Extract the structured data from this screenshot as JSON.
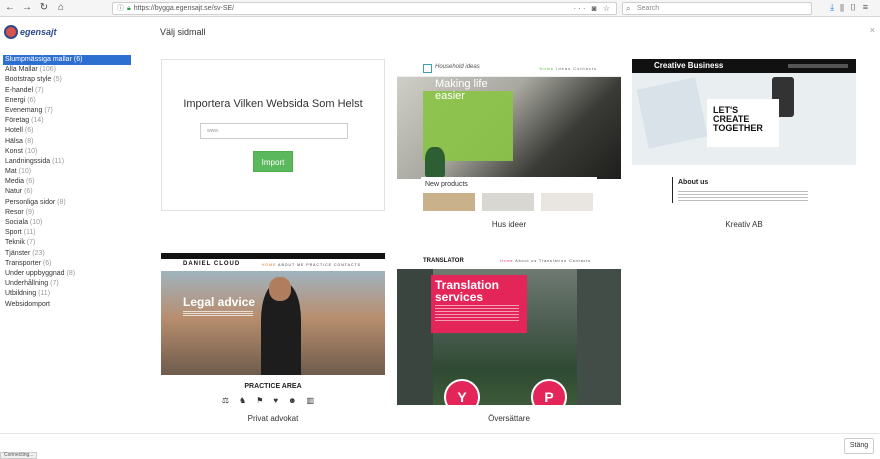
{
  "browser": {
    "url": "https://bygga.egensajt.se/sv-SE/",
    "search_placeholder": "Search",
    "icons": [
      "back-icon",
      "forward-icon",
      "reload-icon",
      "home-icon",
      "info-icon",
      "lock-icon",
      "more-icon",
      "pocket-icon",
      "star-icon",
      "search-icon",
      "download-icon",
      "library-icon",
      "sidebar-icon",
      "menu-icon"
    ]
  },
  "header": {
    "logo_text": "egensajt",
    "title": "Välj sidmall",
    "close_glyph": "×"
  },
  "sidebar": {
    "items": [
      {
        "label": "Slumpmässiga mallar",
        "count": "(6)",
        "active": true
      },
      {
        "label": "Alla Mallar",
        "count": "(106)"
      },
      {
        "label": "Bootstrap style",
        "count": "(5)"
      },
      {
        "label": "E-handel",
        "count": "(7)"
      },
      {
        "label": "Energi",
        "count": "(6)"
      },
      {
        "label": "Evenemang",
        "count": "(7)"
      },
      {
        "label": "Företag",
        "count": "(14)"
      },
      {
        "label": "Hotell",
        "count": "(6)"
      },
      {
        "label": "Hälsa",
        "count": "(8)"
      },
      {
        "label": "Konst",
        "count": "(10)"
      },
      {
        "label": "Landningssida",
        "count": "(11)"
      },
      {
        "label": "Mat",
        "count": "(10)"
      },
      {
        "label": "Media",
        "count": "(6)"
      },
      {
        "label": "Natur",
        "count": "(6)"
      },
      {
        "label": "Personliga sidor",
        "count": "(8)"
      },
      {
        "label": "Resor",
        "count": "(9)"
      },
      {
        "label": "Sociala",
        "count": "(10)"
      },
      {
        "label": "Sport",
        "count": "(11)"
      },
      {
        "label": "Teknik",
        "count": "(7)"
      },
      {
        "label": "Tjänster",
        "count": "(23)"
      },
      {
        "label": "Transporter",
        "count": "(6)"
      },
      {
        "label": "Under uppbyggnad",
        "count": "(8)"
      },
      {
        "label": "Underhållning",
        "count": "(7)"
      },
      {
        "label": "Utbildning",
        "count": "(11)"
      },
      {
        "label": "Websidomport",
        "count": ""
      }
    ]
  },
  "import_card": {
    "title": "Importera Vilken Websida Som Helst",
    "input_placeholder": "www.",
    "button_label": "Import"
  },
  "templates": [
    {
      "label": "Hus ideer",
      "preview": {
        "logo": "Household ideas",
        "nav": [
          "Home",
          "Ideas",
          "Contacts"
        ],
        "hero_title": "Making life easier",
        "section": "New products"
      }
    },
    {
      "label": "Kreativ AB",
      "preview": {
        "logo": "Creative Business",
        "hero_title": "LET'S CREATE TOGETHER",
        "section": "About us"
      }
    },
    {
      "label": "Privat advokat",
      "preview": {
        "logo": "DANIEL CLOUD",
        "nav": [
          "HOME",
          "ABOUT ME",
          "PRACTICE",
          "CONTACTS"
        ],
        "hero_title": "Legal advice",
        "section": "PRACTICE AREA"
      }
    },
    {
      "label": "Översättare",
      "preview": {
        "logo": "TRANSLATOR",
        "nav": [
          "Home",
          "About us",
          "Translation",
          "Contacts"
        ],
        "hero_title": "Translation services",
        "circle_1": "Y",
        "circle_2": "P"
      }
    }
  ],
  "footer": {
    "close_button": "Stäng",
    "status_text": "Connecting..."
  },
  "colors": {
    "accent": "#2d6fd1",
    "import_button": "#5cb85c",
    "translator_pink": "#e3255a",
    "hus_green": "#8bc34a"
  }
}
